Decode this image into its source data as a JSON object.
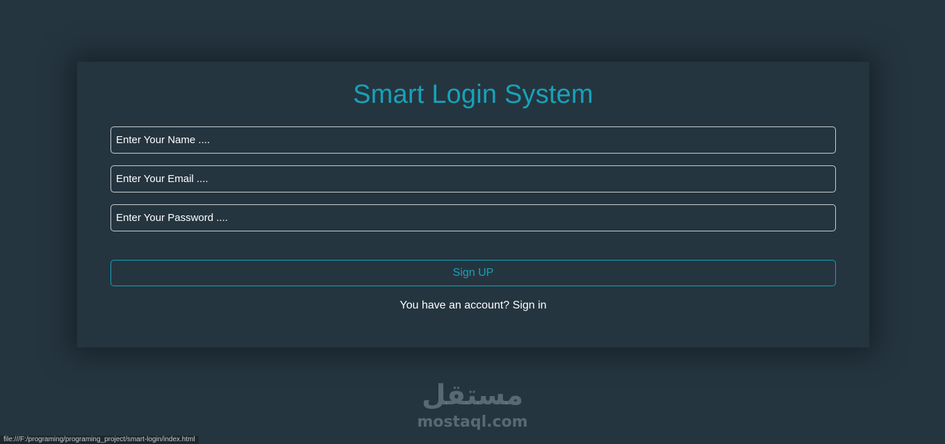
{
  "form": {
    "title": "Smart Login System",
    "name_placeholder": "Enter Your Name ....",
    "email_placeholder": "Enter Your Email ....",
    "password_placeholder": "Enter Your Password ....",
    "signup_label": "Sign UP",
    "account_prompt": "You have an account?",
    "signin_label": "Sign in"
  },
  "watermark": {
    "arabic": "مستقل",
    "latin": "mostaql.com"
  },
  "status_bar": {
    "url": "file:///F:/programing/programing_project/smart-login/index.html"
  },
  "colors": {
    "background": "#253540",
    "accent": "#17a2b8",
    "text": "#ffffff"
  }
}
